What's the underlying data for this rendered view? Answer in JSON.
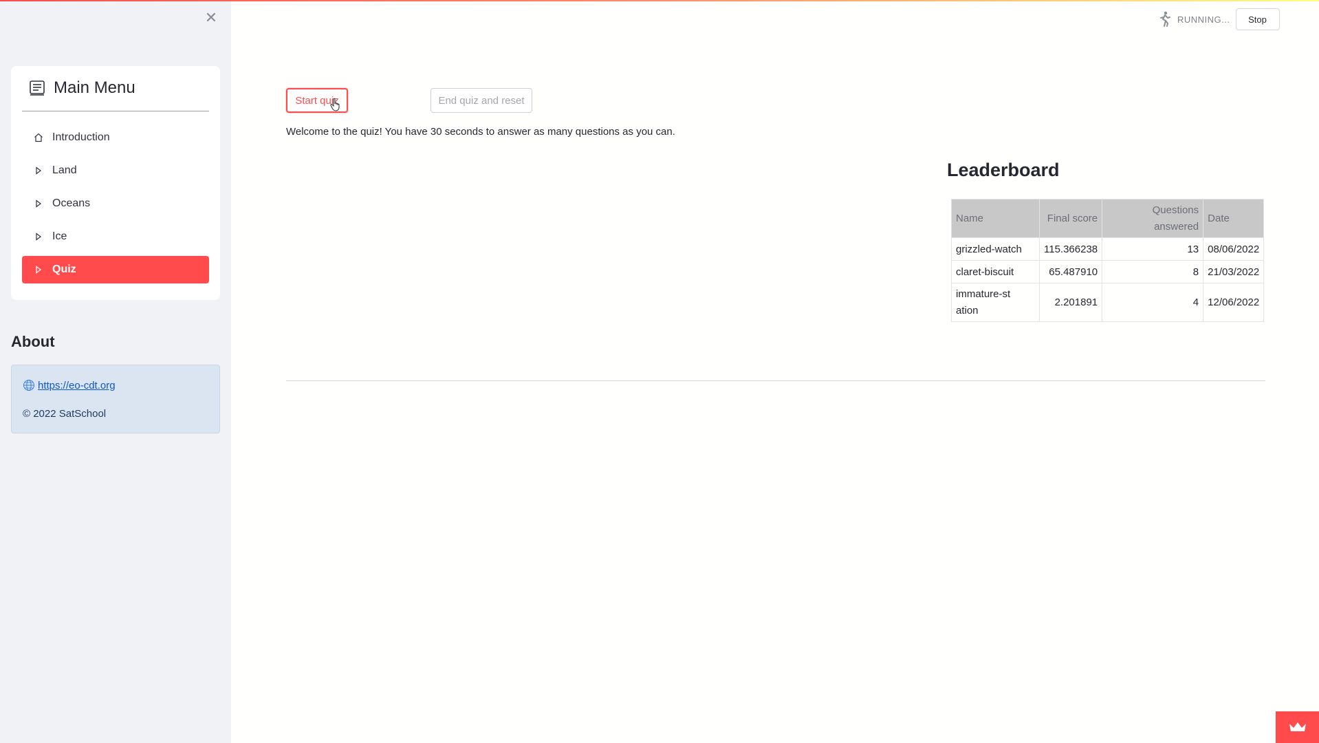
{
  "sidebar": {
    "menu_title": "Main Menu",
    "items": [
      {
        "label": "Introduction",
        "icon": "house-icon"
      },
      {
        "label": "Land",
        "icon": "caret-right-icon"
      },
      {
        "label": "Oceans",
        "icon": "caret-right-icon"
      },
      {
        "label": "Ice",
        "icon": "caret-right-icon"
      },
      {
        "label": "Quiz",
        "icon": "caret-right-icon",
        "active": true
      }
    ],
    "about_title": "About",
    "about_link": "https://eo-cdt.org",
    "about_copyright": "© 2022 SatSchool"
  },
  "status": {
    "text": "RUNNING...",
    "stop_label": "Stop"
  },
  "main": {
    "start_label": "Start quiz",
    "end_label": "End quiz and reset",
    "welcome_text": "Welcome to the quiz! You have 30 seconds to answer as many questions as you can.",
    "leaderboard_title": "Leaderboard",
    "table_headers": [
      "Name",
      "Final score",
      "Questions answered",
      "Date"
    ],
    "rows": [
      {
        "name": "grizzled-watch",
        "score": "115.366238",
        "questions": "13",
        "date": "08/06/2022"
      },
      {
        "name": "claret-biscuit",
        "score": "65.487910",
        "questions": "8",
        "date": "21/03/2022"
      },
      {
        "name": "immature-station",
        "score": "2.201891",
        "questions": "4",
        "date": "12/06/2022"
      }
    ]
  },
  "colors": {
    "accent": "#ff4b4b",
    "sidebar_bg": "#f0f2f6",
    "about_bg": "#dbe5f1"
  }
}
